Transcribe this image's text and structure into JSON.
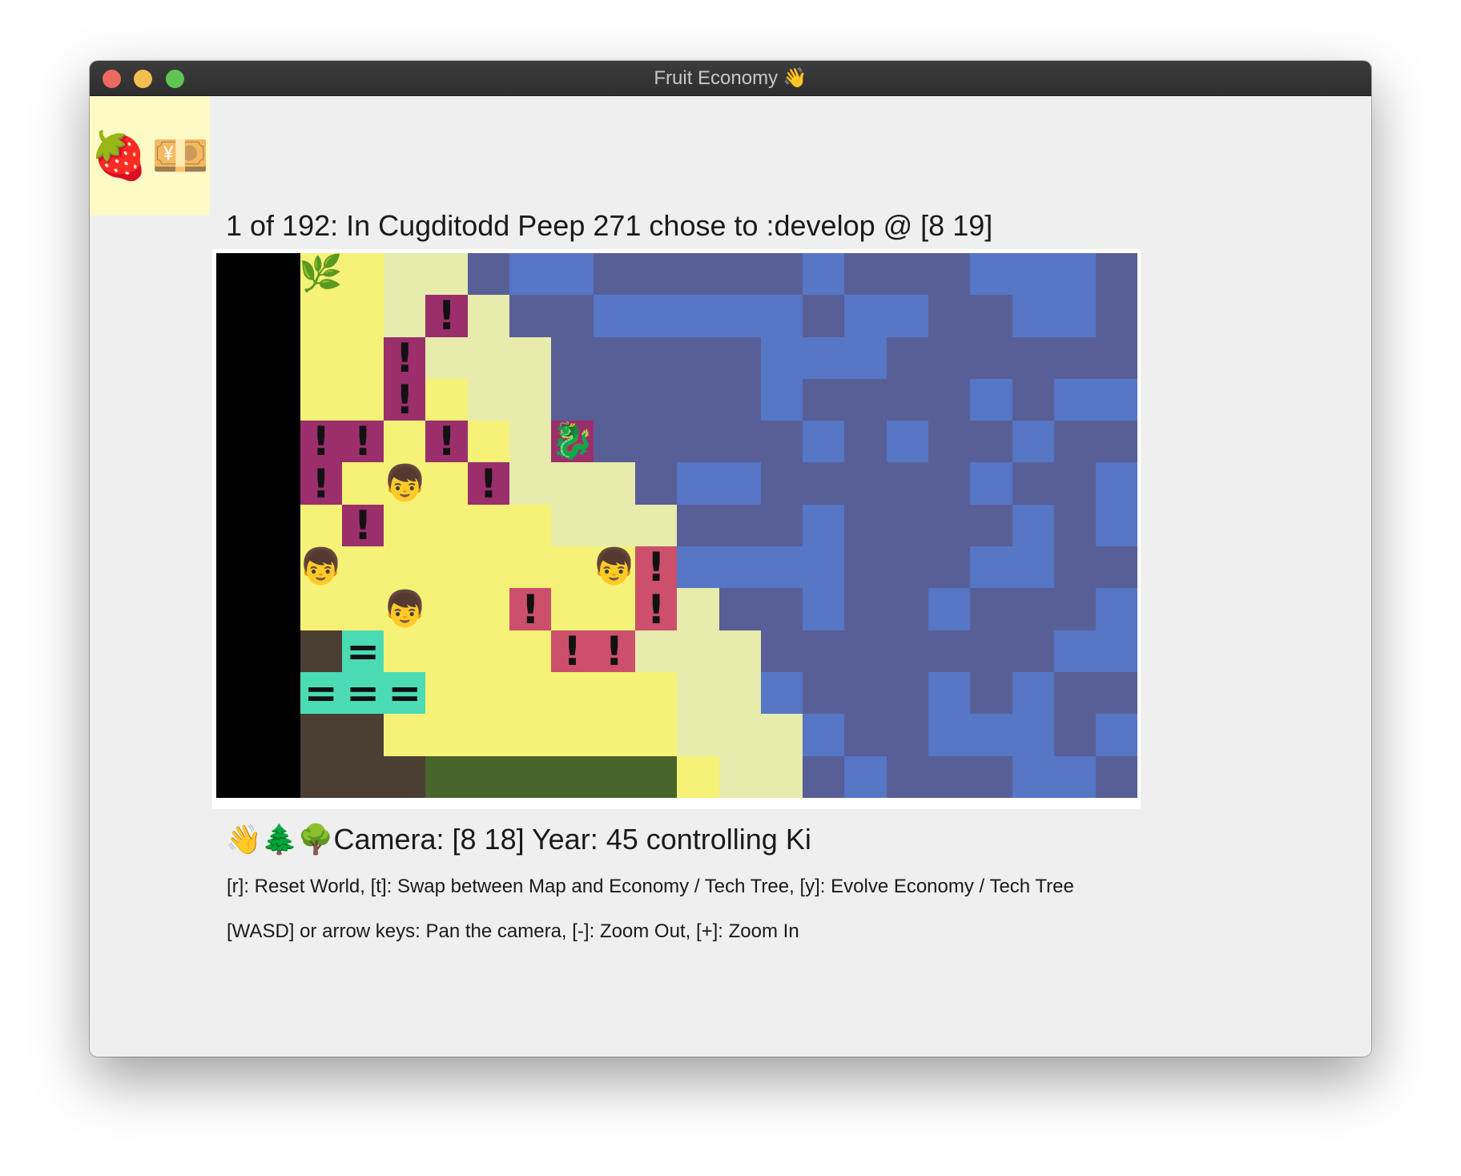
{
  "window": {
    "title": "Fruit Economy 👋"
  },
  "corner_panel": {
    "items": [
      "🍓",
      "💴"
    ]
  },
  "status": {
    "message": "1 of 192: In Cugditodd Peep 271 chose to :develop @ [8 19]"
  },
  "camera_info": {
    "icons": "👋🌲🌳",
    "text": "Camera: [8 18] Year: 45 controlling Ki"
  },
  "help": {
    "line1": "[r]: Reset World, [t]: Swap between Map and Economy / Tech Tree, [y]: Evolve Economy / Tech Tree",
    "line2": "[WASD] or arrow keys: Pan the camera, [-]: Zoom Out, [+]: Zoom In"
  },
  "map": {
    "cols": 22,
    "rows": 13,
    "palette": {
      "K": "#000000",
      "Y": "#f5f277",
      "L": "#e7ebab",
      "D": "#585f97",
      "B": "#5676c6",
      "P": "#9b2f6c",
      "R": "#cc4f6c",
      "T": "#4bdcb4",
      "S": "#4b3f33",
      "G": "#49652c",
      "W": "#ffffff"
    },
    "tile_rows": [
      "KKYYLLDBBDDDDDBDDDBBBD",
      "KKYYLPLDDBBBBBDBBDDBBD",
      "KKYYPLLLDDDDDBBBDDDDDD",
      "KKYYPYLLDDDDDBDDDDBDBB",
      "KKPPYPYLPDDDDDBDBDDBDD",
      "KKPYYYPLLLDBBDDDDDBDDB",
      "KKYPYYYYLLLDDDBDDDDBDB",
      "KKYYYYYYYYRBBBBDDDBBDD",
      "KKYYYYYRYYRLDDBDDBDDDB",
      "KKSTYYYYRRLLLDDDDDDDBB",
      "KKTTTYYYYYYLLBDDDBDBDD",
      "KKSSYYYYYYYLLLBDDBBBDB",
      "KKSSSGGGGGGYLLDBDDDBBD"
    ],
    "entities": [
      {
        "row": 0,
        "col": 2,
        "glyph": "🌿"
      },
      {
        "row": 1,
        "col": 5,
        "glyph": "!"
      },
      {
        "row": 2,
        "col": 4,
        "glyph": "!"
      },
      {
        "row": 3,
        "col": 4,
        "glyph": "!"
      },
      {
        "row": 4,
        "col": 2,
        "glyph": "!"
      },
      {
        "row": 4,
        "col": 3,
        "glyph": "!"
      },
      {
        "row": 4,
        "col": 5,
        "glyph": "!"
      },
      {
        "row": 4,
        "col": 8,
        "glyph": "🐉"
      },
      {
        "row": 5,
        "col": 2,
        "glyph": "!"
      },
      {
        "row": 5,
        "col": 4,
        "glyph": "👦"
      },
      {
        "row": 5,
        "col": 6,
        "glyph": "!"
      },
      {
        "row": 6,
        "col": 3,
        "glyph": "!"
      },
      {
        "row": 7,
        "col": 2,
        "glyph": "👦"
      },
      {
        "row": 7,
        "col": 9,
        "glyph": "👦"
      },
      {
        "row": 7,
        "col": 10,
        "glyph": "!"
      },
      {
        "row": 8,
        "col": 4,
        "glyph": "👦"
      },
      {
        "row": 8,
        "col": 7,
        "glyph": "!"
      },
      {
        "row": 8,
        "col": 10,
        "glyph": "!"
      },
      {
        "row": 9,
        "col": 3,
        "glyph": "="
      },
      {
        "row": 9,
        "col": 8,
        "glyph": "!"
      },
      {
        "row": 9,
        "col": 9,
        "glyph": "!"
      },
      {
        "row": 10,
        "col": 2,
        "glyph": "="
      },
      {
        "row": 10,
        "col": 3,
        "glyph": "="
      },
      {
        "row": 10,
        "col": 4,
        "glyph": "="
      }
    ]
  }
}
